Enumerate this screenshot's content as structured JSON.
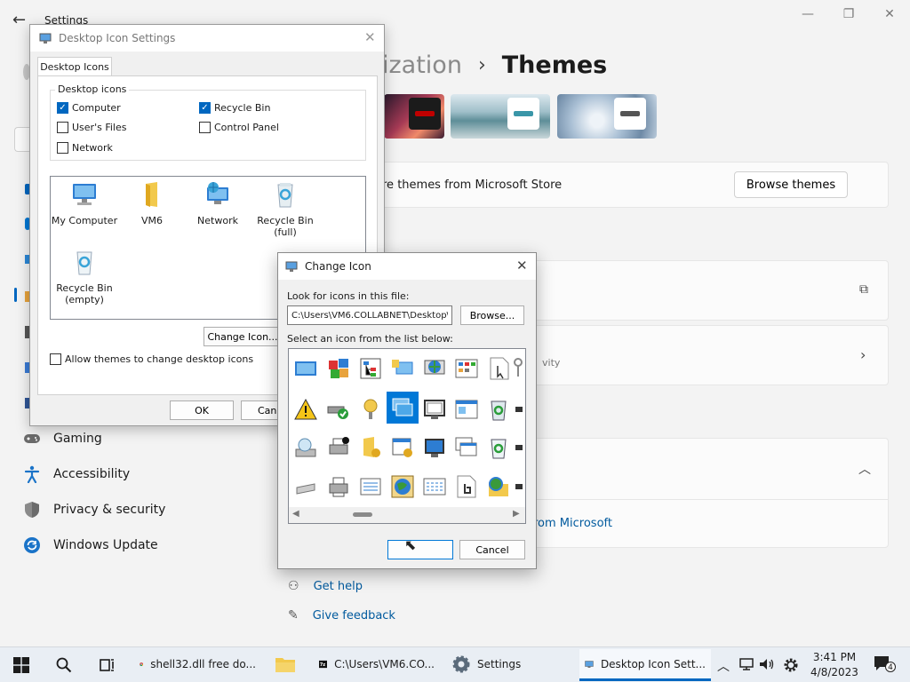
{
  "settings": {
    "title": "Settings",
    "breadcrumb": {
      "parent": "ization",
      "separator": "›",
      "current": "Themes"
    },
    "store_text": "re themes from Microsoft Store",
    "browse_themes": "Browse themes",
    "activity_text": "vity",
    "expander_link": "rom Microsoft",
    "nav": [
      {
        "label": "Gaming",
        "icon": "gaming-icon"
      },
      {
        "label": "Accessibility",
        "icon": "accessibility-icon"
      },
      {
        "label": "Privacy & security",
        "icon": "shield-icon"
      },
      {
        "label": "Windows Update",
        "icon": "update-icon"
      }
    ],
    "help": {
      "get_help": "Get help",
      "give_feedback": "Give feedback"
    }
  },
  "desktop_icon_settings": {
    "title": "Desktop Icon Settings",
    "tab": "Desktop Icons",
    "group_label": "Desktop icons",
    "checkboxes": [
      {
        "label": "Computer",
        "checked": true
      },
      {
        "label": "Recycle Bin",
        "checked": true
      },
      {
        "label": "User's Files",
        "checked": false
      },
      {
        "label": "Control Panel",
        "checked": false
      },
      {
        "label": "Network",
        "checked": false
      }
    ],
    "icons": [
      "My Computer",
      "VM6",
      "Network",
      "Recycle Bin\n(full)",
      "Recycle Bin\n(empty)"
    ],
    "change_icon": "Change Icon...",
    "allow_themes": "Allow themes to change desktop icons",
    "ok": "OK",
    "cancel": "Canc"
  },
  "change_icon": {
    "title": "Change Icon",
    "look_label": "Look for icons in this file:",
    "path": "C:\\Users\\VM6.COLLABNET\\Desktop\\s",
    "browse": "Browse...",
    "select_label": "Select an icon from the list below:",
    "selected_index": 17,
    "cancel": "Cancel"
  },
  "taskbar": {
    "apps": [
      {
        "label": "shell32.dll free do...",
        "icon": "chrome-icon"
      },
      {
        "label": "",
        "icon": "file-explorer-icon"
      },
      {
        "label": "C:\\Users\\VM6.CO...",
        "icon": "7zip-icon"
      },
      {
        "label": "Settings",
        "icon": "settings-gear-icon"
      },
      {
        "label": "Desktop Icon Sett...",
        "icon": "desktop-icon-settings-icon"
      }
    ],
    "time": "3:41 PM",
    "date": "4/8/2023",
    "notifications": "4"
  },
  "colors": {
    "accent": "#0067c0",
    "link": "#005a9e",
    "selection": "#0078d7"
  }
}
